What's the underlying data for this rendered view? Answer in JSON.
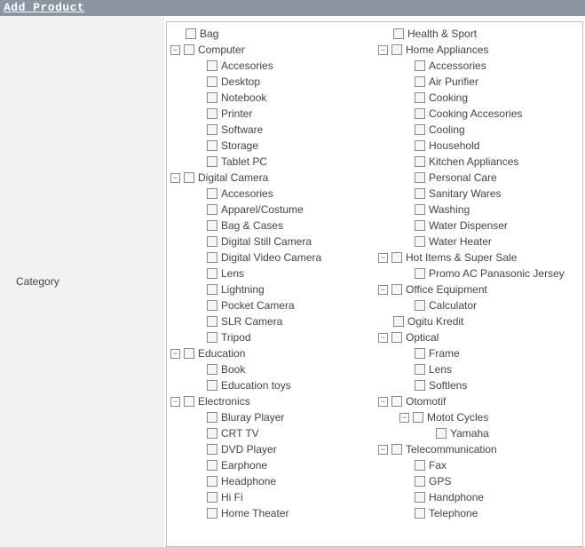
{
  "title": "Add Product",
  "field_label": "Category",
  "toggle_glyph": "−",
  "columns": [
    [
      {
        "label": "Bag",
        "depth": 0,
        "expandable": false
      },
      {
        "label": "Computer",
        "depth": 0,
        "expandable": true
      },
      {
        "label": "Accesories",
        "depth": 1,
        "expandable": false
      },
      {
        "label": "Desktop",
        "depth": 1,
        "expandable": false
      },
      {
        "label": "Notebook",
        "depth": 1,
        "expandable": false
      },
      {
        "label": "Printer",
        "depth": 1,
        "expandable": false
      },
      {
        "label": "Software",
        "depth": 1,
        "expandable": false
      },
      {
        "label": "Storage",
        "depth": 1,
        "expandable": false
      },
      {
        "label": "Tablet PC",
        "depth": 1,
        "expandable": false
      },
      {
        "label": "Digital Camera",
        "depth": 0,
        "expandable": true
      },
      {
        "label": "Accesories",
        "depth": 1,
        "expandable": false
      },
      {
        "label": "Apparel/Costume",
        "depth": 1,
        "expandable": false
      },
      {
        "label": "Bag & Cases",
        "depth": 1,
        "expandable": false
      },
      {
        "label": "Digital Still Camera",
        "depth": 1,
        "expandable": false
      },
      {
        "label": "Digital Video Camera",
        "depth": 1,
        "expandable": false
      },
      {
        "label": "Lens",
        "depth": 1,
        "expandable": false
      },
      {
        "label": "Lightning",
        "depth": 1,
        "expandable": false
      },
      {
        "label": "Pocket Camera",
        "depth": 1,
        "expandable": false
      },
      {
        "label": "SLR Camera",
        "depth": 1,
        "expandable": false
      },
      {
        "label": "Tripod",
        "depth": 1,
        "expandable": false
      },
      {
        "label": "Education",
        "depth": 0,
        "expandable": true
      },
      {
        "label": "Book",
        "depth": 1,
        "expandable": false
      },
      {
        "label": "Education toys",
        "depth": 1,
        "expandable": false
      },
      {
        "label": "Electronics",
        "depth": 0,
        "expandable": true
      },
      {
        "label": "Bluray Player",
        "depth": 1,
        "expandable": false
      },
      {
        "label": "CRT TV",
        "depth": 1,
        "expandable": false
      },
      {
        "label": "DVD Player",
        "depth": 1,
        "expandable": false
      },
      {
        "label": "Earphone",
        "depth": 1,
        "expandable": false
      },
      {
        "label": "Headphone",
        "depth": 1,
        "expandable": false
      },
      {
        "label": "Hi Fi",
        "depth": 1,
        "expandable": false
      },
      {
        "label": "Home Theater",
        "depth": 1,
        "expandable": false
      }
    ],
    [
      {
        "label": "Health & Sport",
        "depth": 0,
        "expandable": false
      },
      {
        "label": "Home Appliances",
        "depth": 0,
        "expandable": true
      },
      {
        "label": "Accessories",
        "depth": 1,
        "expandable": false
      },
      {
        "label": "Air Purifier",
        "depth": 1,
        "expandable": false
      },
      {
        "label": "Cooking",
        "depth": 1,
        "expandable": false
      },
      {
        "label": "Cooking Accesories",
        "depth": 1,
        "expandable": false
      },
      {
        "label": "Cooling",
        "depth": 1,
        "expandable": false
      },
      {
        "label": "Household",
        "depth": 1,
        "expandable": false
      },
      {
        "label": "Kitchen Appliances",
        "depth": 1,
        "expandable": false
      },
      {
        "label": "Personal Care",
        "depth": 1,
        "expandable": false
      },
      {
        "label": "Sanitary Wares",
        "depth": 1,
        "expandable": false
      },
      {
        "label": "Washing",
        "depth": 1,
        "expandable": false
      },
      {
        "label": "Water Dispenser",
        "depth": 1,
        "expandable": false
      },
      {
        "label": "Water Heater",
        "depth": 1,
        "expandable": false
      },
      {
        "label": "Hot Items & Super Sale",
        "depth": 0,
        "expandable": true
      },
      {
        "label": "Promo AC Panasonic Jersey",
        "depth": 1,
        "expandable": false
      },
      {
        "label": "Office Equipment",
        "depth": 0,
        "expandable": true
      },
      {
        "label": "Calculator",
        "depth": 1,
        "expandable": false
      },
      {
        "label": "Ogitu Kredit",
        "depth": 0,
        "expandable": false
      },
      {
        "label": "Optical",
        "depth": 0,
        "expandable": true
      },
      {
        "label": "Frame",
        "depth": 1,
        "expandable": false
      },
      {
        "label": "Lens",
        "depth": 1,
        "expandable": false
      },
      {
        "label": "Softlens",
        "depth": 1,
        "expandable": false
      },
      {
        "label": "Otomotif",
        "depth": 0,
        "expandable": true
      },
      {
        "label": "Motot Cycles",
        "depth": 1,
        "expandable": true
      },
      {
        "label": "Yamaha",
        "depth": 2,
        "expandable": false
      },
      {
        "label": "Telecommunication",
        "depth": 0,
        "expandable": true
      },
      {
        "label": "Fax",
        "depth": 1,
        "expandable": false
      },
      {
        "label": "GPS",
        "depth": 1,
        "expandable": false
      },
      {
        "label": "Handphone",
        "depth": 1,
        "expandable": false
      },
      {
        "label": "Telephone",
        "depth": 1,
        "expandable": false
      }
    ]
  ]
}
